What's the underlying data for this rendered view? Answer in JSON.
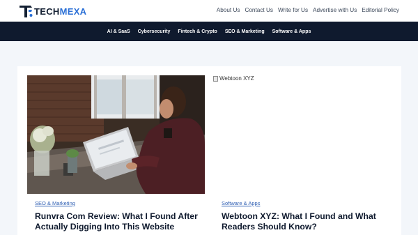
{
  "header": {
    "logo_text_main": "TECH",
    "logo_text_accent": "MEXA",
    "nav": [
      "About Us",
      "Contact Us",
      "Write for Us",
      "Advertise with Us",
      "Editorial Policy"
    ]
  },
  "categories": [
    "AI & SaaS",
    "Cybersecurity",
    "Fintech & Crypto",
    "SEO & Marketing",
    "Software & Apps"
  ],
  "posts": [
    {
      "category": "SEO & Marketing",
      "title": "Runvra Com Review: What I Found After Actually Digging Into This Website",
      "image": "photo-man-laptop"
    },
    {
      "category": "Software & Apps",
      "title": "Webtoon XYZ: What I Found and What Readers Should Know?",
      "image_alt": "Webtoon XYZ"
    }
  ],
  "colors": {
    "nav_bar": "#0f1a2e",
    "link": "#2f5fb3",
    "page_bg": "#f3f6fa"
  }
}
